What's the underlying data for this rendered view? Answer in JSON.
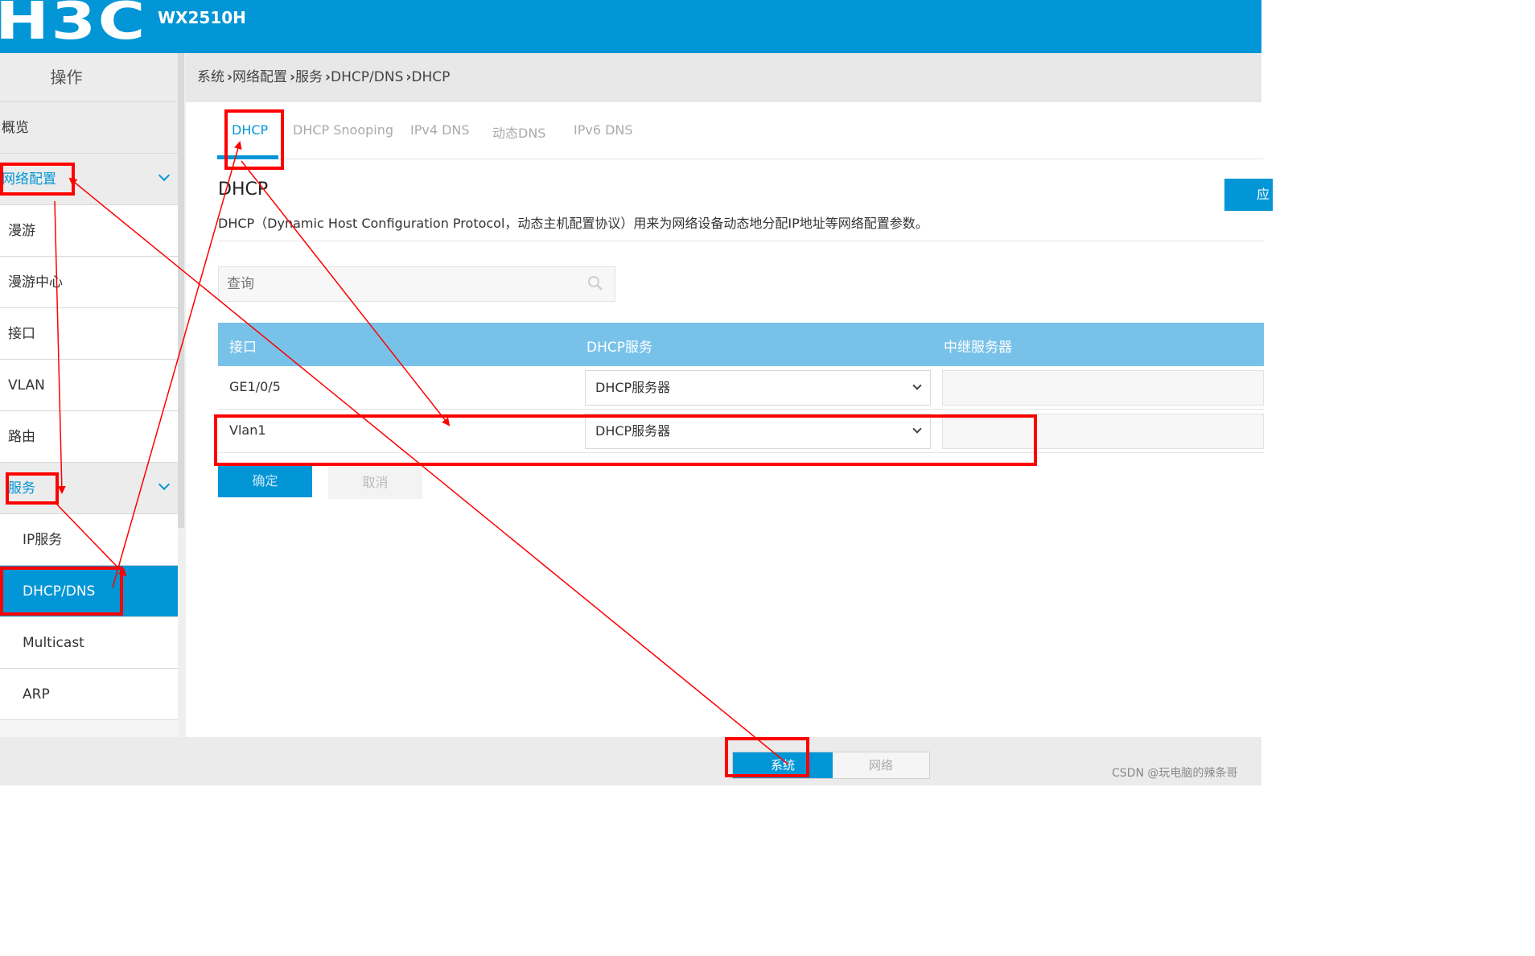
{
  "header": {
    "logo": "H3C",
    "model": "WX2510H"
  },
  "sidebar": {
    "title": "操作",
    "items": [
      {
        "label": "概览"
      },
      {
        "label": "网络配置"
      },
      {
        "label": "漫游"
      },
      {
        "label": "漫游中心"
      },
      {
        "label": "接口"
      },
      {
        "label": "VLAN"
      },
      {
        "label": "路由"
      },
      {
        "label": "服务"
      },
      {
        "label": "IP服务"
      },
      {
        "label": "DHCP/DNS"
      },
      {
        "label": "Multicast"
      },
      {
        "label": "ARP"
      }
    ]
  },
  "breadcrumb": [
    "系统",
    "网络配置",
    "服务",
    "DHCP/DNS",
    "DHCP"
  ],
  "tabs": [
    "DHCP",
    "DHCP Snooping",
    "IPv4 DNS",
    "动态DNS",
    "IPv6 DNS"
  ],
  "page": {
    "title": "DHCP",
    "description": "DHCP（Dynamic Host Configuration Protocol，动态主机配置协议）用来为网络设备动态地分配IP地址等网络配置参数。",
    "top_button": "应"
  },
  "search": {
    "placeholder": "查询"
  },
  "table": {
    "headers": [
      "接口",
      "DHCP服务",
      "中继服务器"
    ],
    "rows": [
      {
        "interface": "GE1/0/5",
        "service": "DHCP服务器"
      },
      {
        "interface": "Vlan1",
        "service": "DHCP服务器"
      }
    ]
  },
  "buttons": {
    "ok": "确定",
    "cancel": "取消"
  },
  "footer": {
    "switch_on": "系统",
    "switch_off": "网络",
    "watermark": "CSDN @玩电脑的辣条哥"
  },
  "colors": {
    "brand": "#0396d6",
    "table_header": "#78c2ea",
    "annotation": "#ff0000"
  }
}
